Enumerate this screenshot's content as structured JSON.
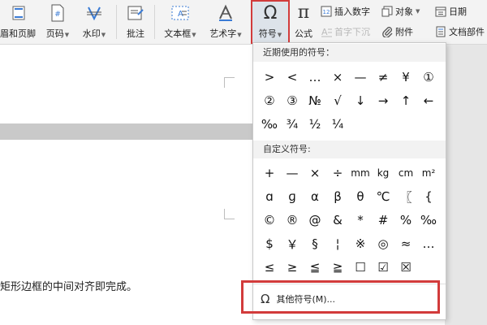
{
  "ribbon": {
    "header_footer_label": "眉和页脚",
    "page_number_label": "页码",
    "watermark_label": "水印",
    "comment_label": "批注",
    "textbox_label": "文本框",
    "wordart_label": "艺术字",
    "symbol_label": "符号",
    "formula_label": "公式",
    "insert_number_label": "插入数字",
    "object_label": "对象",
    "date_label": "日期",
    "dropcap_label": "首字下沉",
    "attachment_label": "附件",
    "docparts_label": "文档部件"
  },
  "dropdown": {
    "recent_header": "近期使用的符号：",
    "recent_symbols": [
      ">",
      "<",
      "…",
      "×",
      "—",
      "≠",
      "¥",
      "①",
      "②",
      "③",
      "№",
      "√",
      "↓",
      "→",
      "↑",
      "←",
      "‰",
      "¾",
      "½",
      "¼"
    ],
    "custom_header": "自定义符号:",
    "custom_symbols": [
      "+",
      "—",
      "×",
      "÷",
      "mm",
      "kg",
      "cm",
      "m²",
      "ɑ",
      "ɡ",
      "α",
      "β",
      "θ",
      "℃",
      "〖",
      "{",
      "©",
      "®",
      "@",
      "&",
      "*",
      "#",
      "%",
      "‰",
      "$",
      "￥",
      "§",
      "¦",
      "※",
      "◎",
      "≈",
      "…",
      "≤",
      "≥",
      "≦",
      "≧",
      "☐",
      "☑",
      "☒"
    ],
    "more_symbols_label": "其他符号(M)..."
  },
  "document": {
    "text": "矩形边框的中间对齐即完成。"
  },
  "colors": {
    "highlight": "#d23b3b",
    "ribbon_bg": "#f3f3f3",
    "section_header_bg": "#f2f2f2"
  }
}
